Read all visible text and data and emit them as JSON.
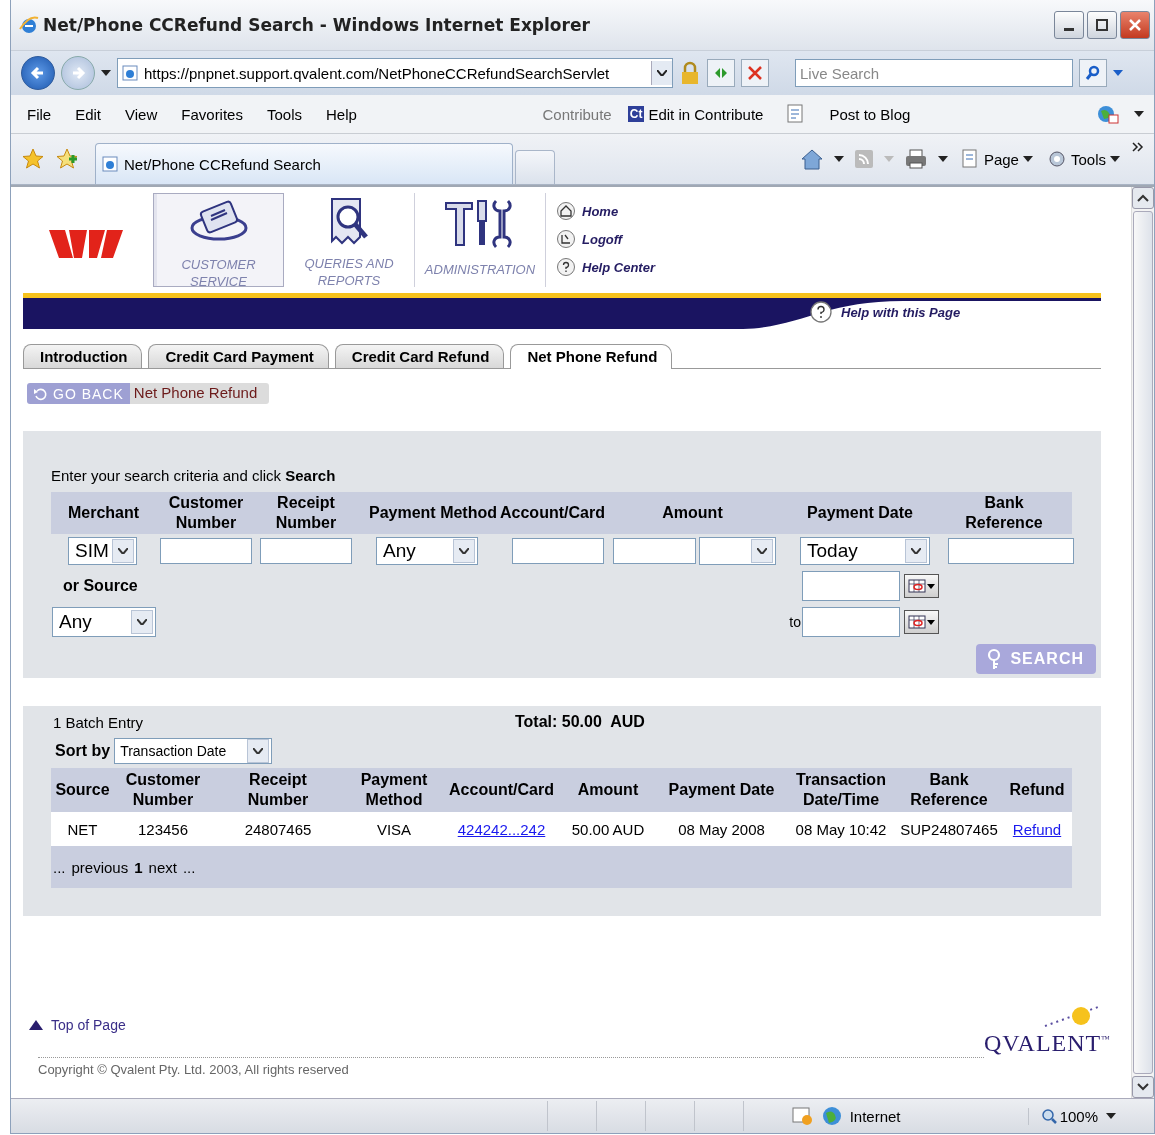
{
  "window": {
    "title": "Net/Phone CCRefund Search - Windows Internet Explorer"
  },
  "address_bar": {
    "url": "https://pnpnet.support.qvalent.com/NetPhoneCCRefundSearchServlet"
  },
  "search_box": {
    "placeholder": "Live Search"
  },
  "menu": [
    "File",
    "Edit",
    "View",
    "Favorites",
    "Tools",
    "Help"
  ],
  "contribute": {
    "label": "Contribute",
    "badge": "Ct",
    "edit": "Edit in Contribute",
    "blog": "Post to Blog"
  },
  "browser_tab": {
    "title": "Net/Phone CCRefund Search"
  },
  "command_bar": [
    "Page",
    "Tools"
  ],
  "header": {
    "sections": [
      {
        "label": "CUSTOMER SERVICE",
        "kind": "card",
        "selected": true
      },
      {
        "label": "QUERIES AND REPORTS",
        "kind": "report",
        "selected": false
      },
      {
        "label": "ADMINISTRATION",
        "kind": "tools",
        "selected": false
      }
    ],
    "links": [
      {
        "label": "Home",
        "kind": "home"
      },
      {
        "label": "Logoff",
        "kind": "logoff"
      },
      {
        "label": "Help Center",
        "kind": "help"
      }
    ],
    "help": "Help with this Page"
  },
  "tabs": [
    {
      "label": "Introduction",
      "selected": false
    },
    {
      "label": "Credit Card Payment",
      "selected": false
    },
    {
      "label": "Credit Card Refund",
      "selected": false
    },
    {
      "label": "Net Phone Refund",
      "selected": true
    }
  ],
  "breadcrumb": {
    "back": "GO BACK",
    "current": "Net Phone Refund"
  },
  "search": {
    "instruction": "Enter your search criteria and click **Search**",
    "columns": [
      "Merchant",
      "Customer Number",
      "Receipt Number",
      "Payment Method",
      "Account/Card",
      "Amount",
      "Payment Date",
      "Bank Reference"
    ],
    "fields": [
      [
        {
          "kind": "select",
          "value": "SIM"
        }
      ],
      [
        {
          "kind": "input"
        }
      ],
      [
        {
          "kind": "input"
        }
      ],
      [
        {
          "kind": "select",
          "value": "Any"
        }
      ],
      [
        {
          "kind": "input"
        }
      ],
      [
        {
          "kind": "input"
        },
        {
          "kind": "select"
        }
      ],
      [
        {
          "kind": "select",
          "value": "Today"
        }
      ],
      [
        {
          "kind": "input"
        }
      ]
    ],
    "source_label": "or Source",
    "source_value": "Any",
    "date_to_label": "to",
    "button": "SEARCH"
  },
  "results": {
    "count": "1 Batch Entry",
    "total": "Total: 50.00  AUD",
    "sort_label": "Sort by",
    "sort_value": "Transaction Date",
    "columns": [
      "Source",
      "Customer Number",
      "Receipt Number",
      "Payment Method",
      "Account/Card",
      "Amount",
      "Payment Date",
      "Transaction Date/Time",
      "Bank Reference",
      "Refund"
    ],
    "rows": [
      [
        {
          "text": "NET",
          "kind": "text"
        },
        {
          "text": "123456",
          "kind": "text"
        },
        {
          "text": "24807465",
          "kind": "text"
        },
        {
          "text": "VISA",
          "kind": "text"
        },
        {
          "text": "424242...242",
          "kind": "link"
        },
        {
          "text": "50.00 AUD",
          "kind": "text"
        },
        {
          "text": "08 May 2008",
          "kind": "text"
        },
        {
          "text": "08 May 10:42",
          "kind": "text"
        },
        {
          "text": "SUP24807465",
          "kind": "text"
        },
        {
          "text": "Refund",
          "kind": "link"
        }
      ]
    ],
    "pager": {
      "before": "...",
      "previous": "previous",
      "page": "1",
      "next": "next",
      "after": "..."
    }
  },
  "footer": {
    "top_link": "Top of Page",
    "copyright": "Copyright © Qvalent Pty. Ltd. 2003, All rights reserved",
    "logo": "QVALENT",
    "logo_mark": "™"
  },
  "status_bar": {
    "zone": "Internet",
    "zoom": "100%"
  }
}
